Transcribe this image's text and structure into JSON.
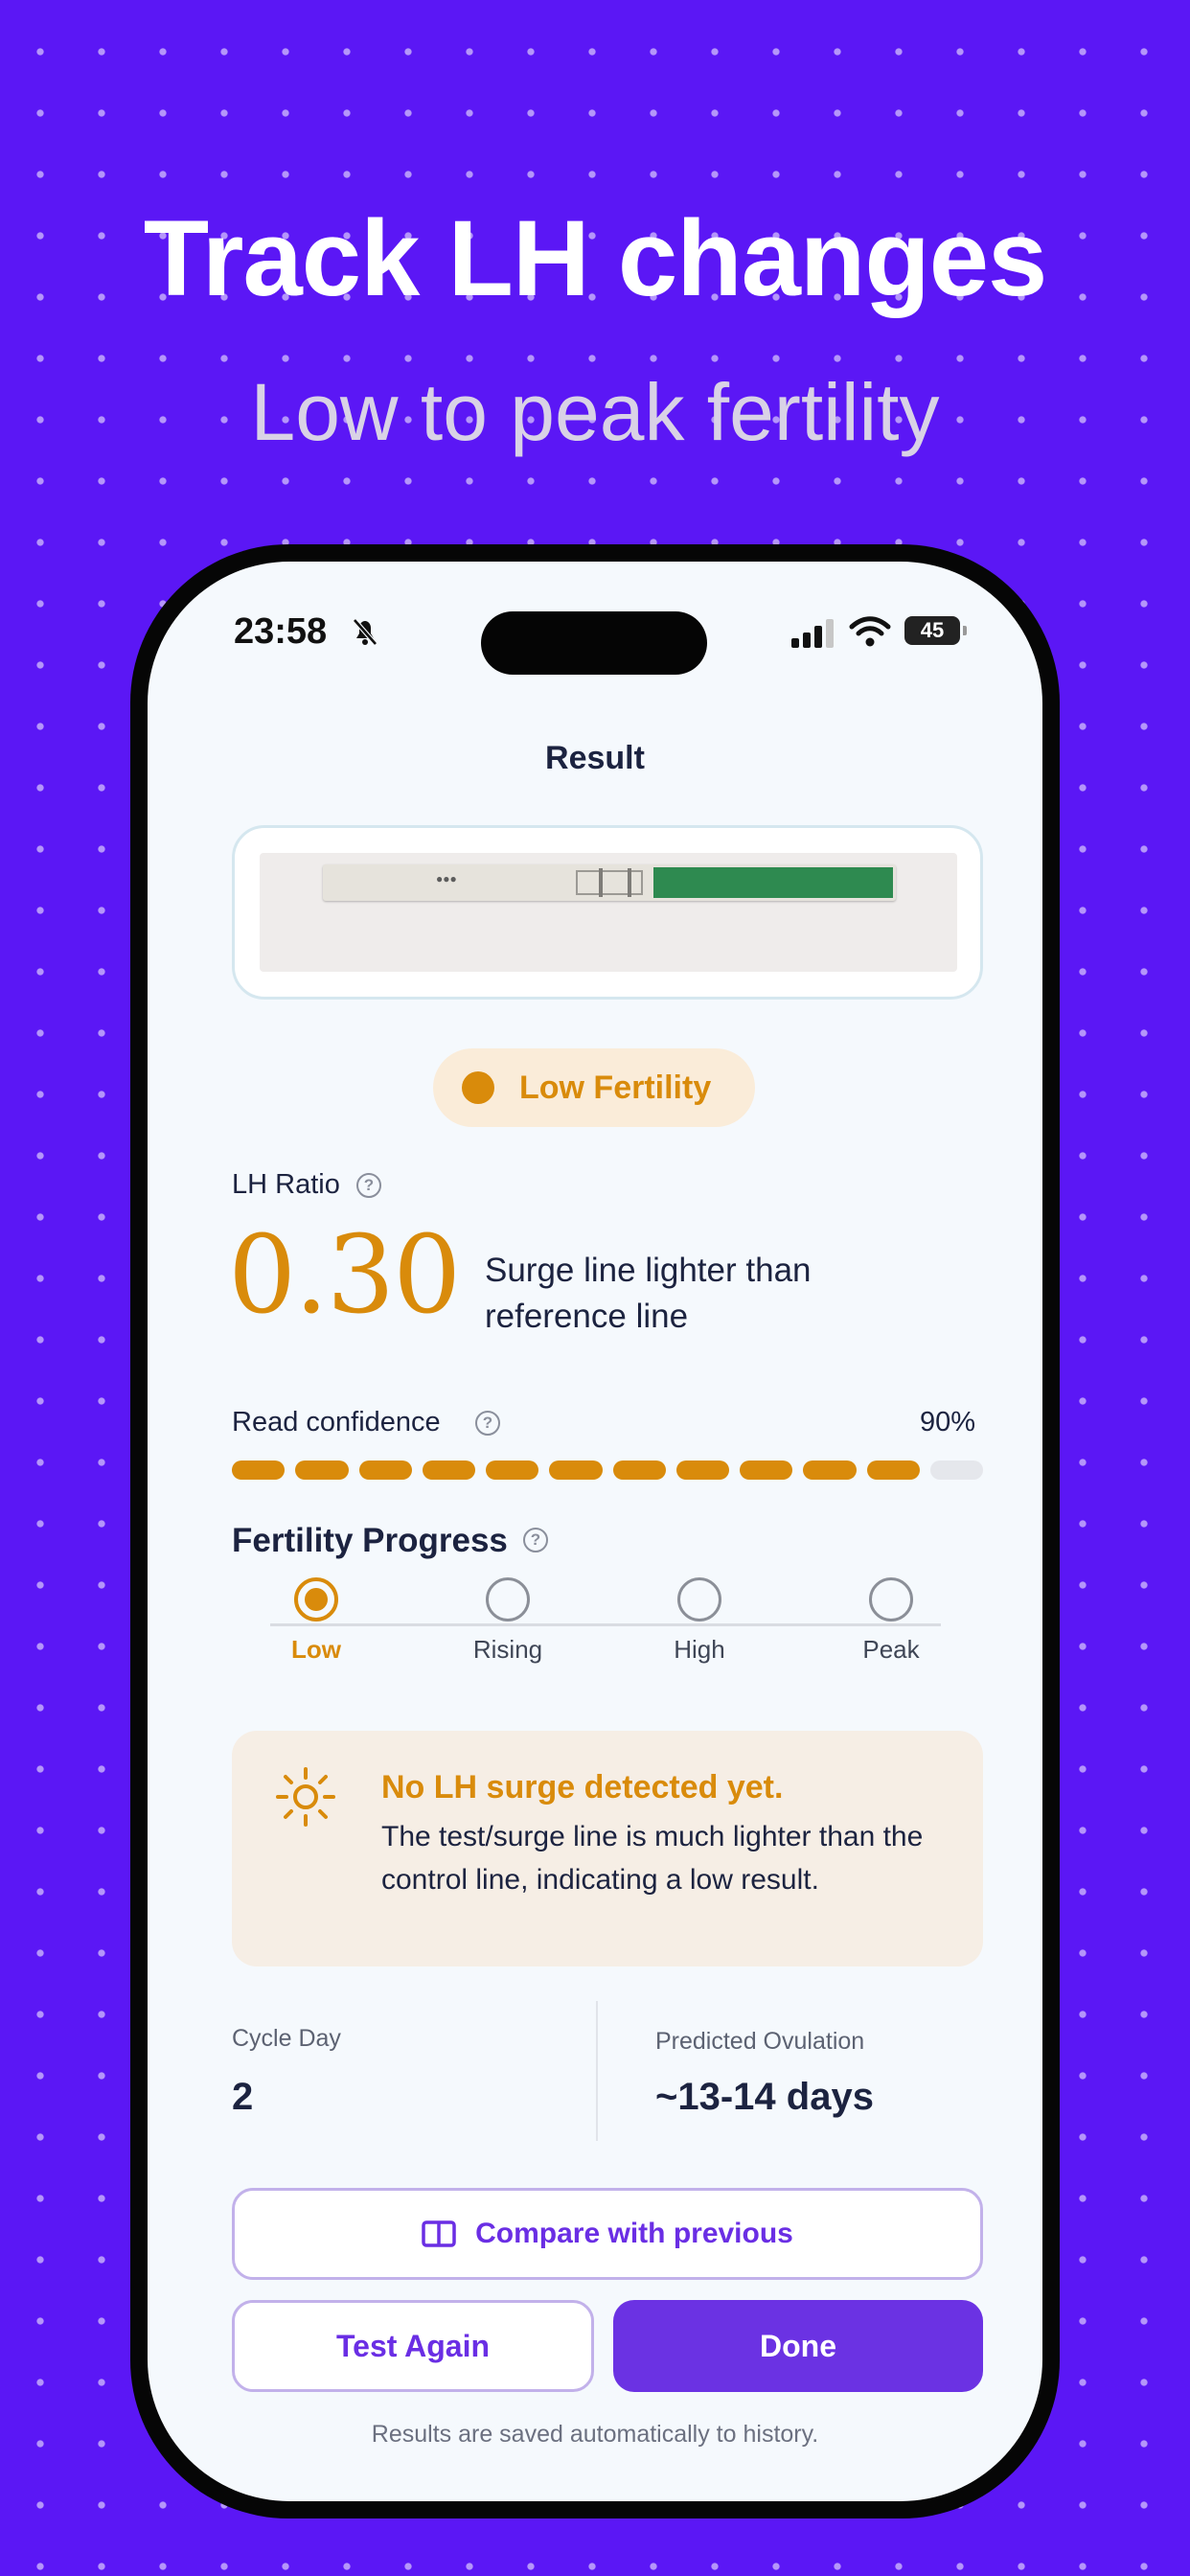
{
  "promo": {
    "headline": "Track LH changes",
    "subheadline": "Low to peak fertility"
  },
  "status_bar": {
    "time": "23:58",
    "battery": "45",
    "icons": [
      "bell-slash-icon",
      "cellular-signal-icon",
      "wifi-icon",
      "battery-icon"
    ]
  },
  "screen": {
    "title": "Result"
  },
  "result_badge": {
    "label": "Low Fertility",
    "color": "#d98b0b"
  },
  "lh_ratio": {
    "label": "LH Ratio",
    "value": "0.30",
    "description": "Surge line lighter than reference line"
  },
  "read_confidence": {
    "label": "Read confidence",
    "value_text": "90%",
    "percent": 90,
    "segments_total": 12,
    "segments_filled": 11
  },
  "fertility_progress": {
    "label": "Fertility Progress",
    "steps": [
      {
        "label": "Low",
        "active": true
      },
      {
        "label": "Rising",
        "active": false
      },
      {
        "label": "High",
        "active": false
      },
      {
        "label": "Peak",
        "active": false
      }
    ]
  },
  "alert": {
    "icon": "sun-icon",
    "title": "No LH surge detected yet.",
    "body": "The test/surge line is much lighter than the control line, indicating a low result."
  },
  "stats": {
    "cycle_day_label": "Cycle Day",
    "cycle_day_value": "2",
    "ovulation_label": "Predicted Ovulation",
    "ovulation_value": "~13-14 days"
  },
  "actions": {
    "compare_label": "Compare with previous",
    "compare_icon": "book-open-icon",
    "test_again_label": "Test Again",
    "done_label": "Done"
  },
  "footnote": "Results are saved automatically to history.",
  "colors": {
    "background": "#5b17f5",
    "accent": "#6b32e3",
    "warning": "#d98b0b"
  }
}
